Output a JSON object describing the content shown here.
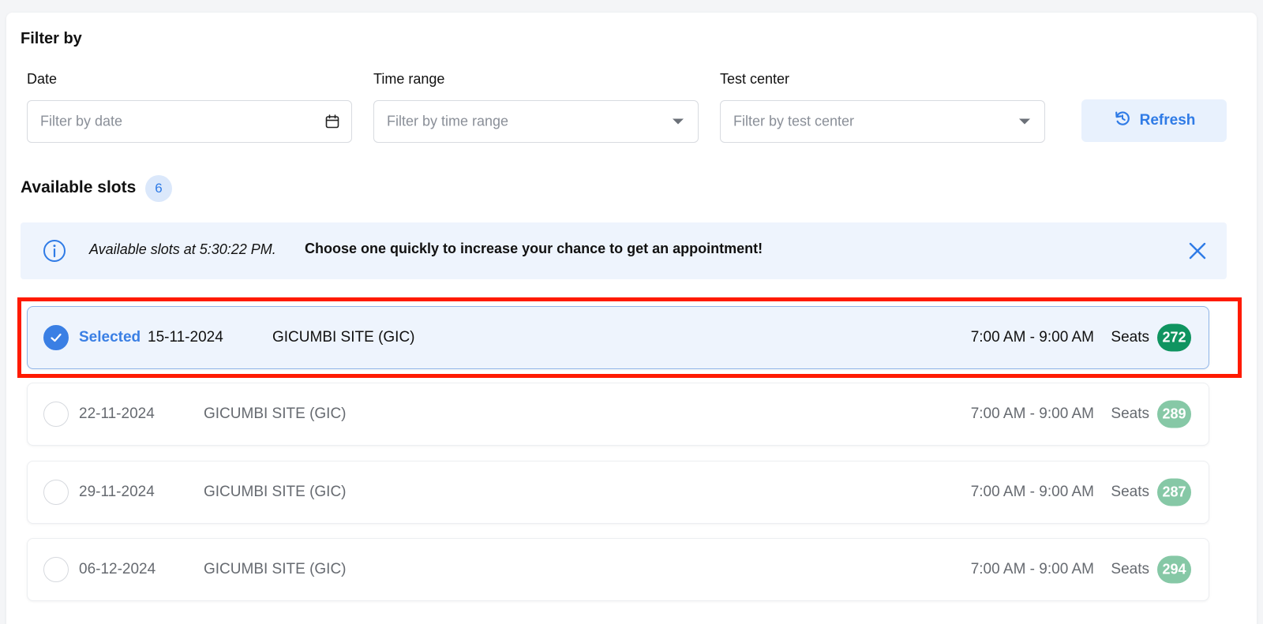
{
  "filter": {
    "title": "Filter by",
    "date": {
      "label": "Date",
      "placeholder": "Filter by date"
    },
    "time_range": {
      "label": "Time range",
      "placeholder": "Filter by time range"
    },
    "test_center": {
      "label": "Test center",
      "placeholder": "Filter by test center"
    },
    "refresh_label": "Refresh"
  },
  "slots_section": {
    "title": "Available slots",
    "count": "6"
  },
  "info_banner": {
    "time_text": "Available slots at 5:30:22 PM.",
    "cta_text": "Choose one quickly to increase your chance to get an appointment!"
  },
  "slots": [
    {
      "selected": true,
      "selected_label": "Selected",
      "date": "15-11-2024",
      "site": "GICUMBI SITE (GIC)",
      "time": "7:00 AM - 9:00 AM",
      "seats_label": "Seats",
      "seats": "272"
    },
    {
      "selected": false,
      "date": "22-11-2024",
      "site": "GICUMBI SITE (GIC)",
      "time": "7:00 AM - 9:00 AM",
      "seats_label": "Seats",
      "seats": "289"
    },
    {
      "selected": false,
      "date": "29-11-2024",
      "site": "GICUMBI SITE (GIC)",
      "time": "7:00 AM - 9:00 AM",
      "seats_label": "Seats",
      "seats": "287"
    },
    {
      "selected": false,
      "date": "06-12-2024",
      "site": "GICUMBI SITE (GIC)",
      "time": "7:00 AM - 9:00 AM",
      "seats_label": "Seats",
      "seats": "294"
    }
  ],
  "colors": {
    "accent": "#3a7fe4",
    "seats_selected": "#0f9460",
    "seats_default": "#86c8a6",
    "highlight": "#ff1a00"
  },
  "icons": {
    "date_field": "calendar-icon",
    "dropdown": "chevron-down-icon",
    "refresh": "refresh-icon",
    "info": "info-icon",
    "close": "close-icon",
    "check": "check-icon"
  }
}
